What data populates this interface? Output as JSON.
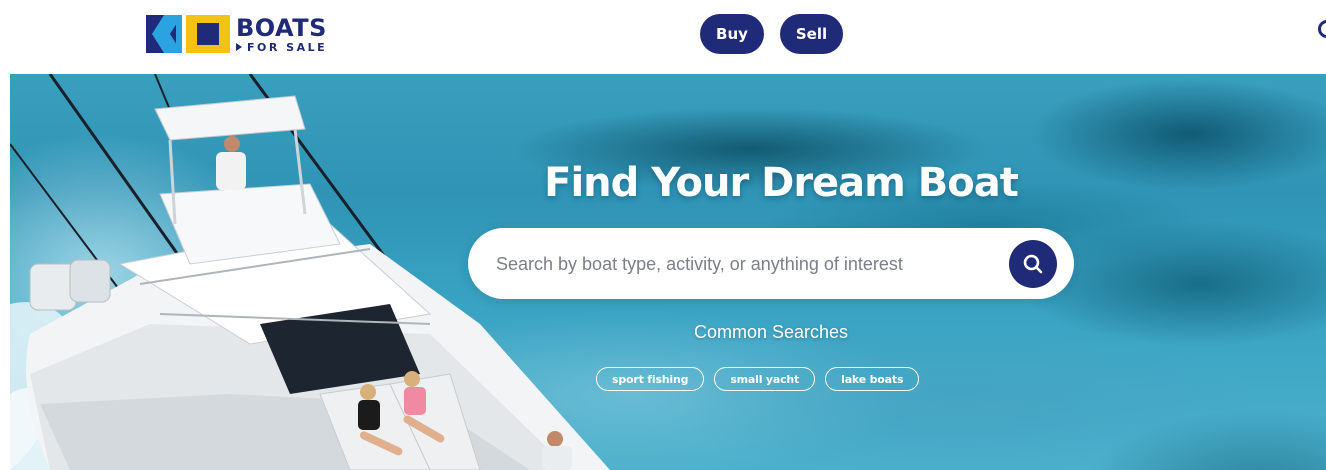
{
  "brand": {
    "name": "BOATS",
    "tagline": "FOR SALE",
    "colors": {
      "navy": "#1f2a78",
      "sky": "#2aa3e0",
      "yellow": "#f3c213"
    }
  },
  "header": {
    "nav": [
      {
        "label": "Buy"
      },
      {
        "label": "Sell"
      }
    ],
    "search_icon": "search-icon"
  },
  "hero": {
    "title": "Find Your Dream Boat",
    "search": {
      "placeholder": "Search by boat type, activity, or anything of interest",
      "value": "",
      "button_icon": "search-icon"
    },
    "common_searches_label": "Common Searches",
    "common_searches": [
      {
        "label": "sport fishing"
      },
      {
        "label": "small yacht"
      },
      {
        "label": "lake boats"
      }
    ]
  }
}
